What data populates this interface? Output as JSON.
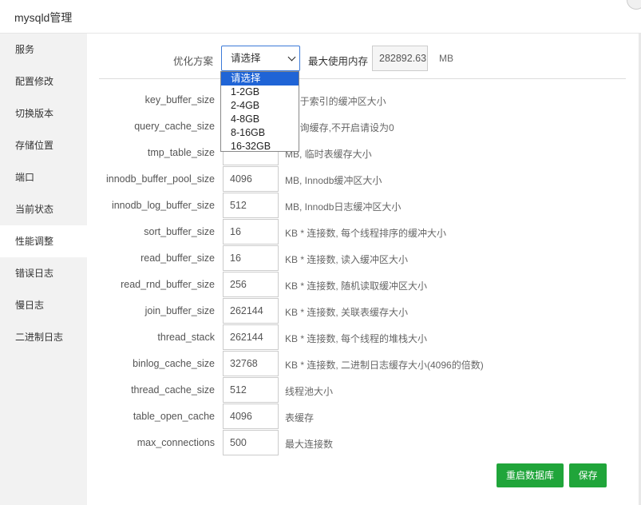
{
  "window": {
    "title": "mysqld管理"
  },
  "sidebar": {
    "items": [
      {
        "label": "服务"
      },
      {
        "label": "配置修改"
      },
      {
        "label": "切换版本"
      },
      {
        "label": "存储位置"
      },
      {
        "label": "端口"
      },
      {
        "label": "当前状态"
      },
      {
        "label": "性能调整",
        "active": true
      },
      {
        "label": "错误日志"
      },
      {
        "label": "慢日志"
      },
      {
        "label": "二进制日志"
      }
    ]
  },
  "optimize": {
    "label": "优化方案",
    "selected": "请选择",
    "options": [
      "请选择",
      "1-2GB",
      "2-4GB",
      "4-8GB",
      "8-16GB",
      "16-32GB"
    ],
    "max_mem_label": "最大使用内存",
    "max_mem_value": "282892.63",
    "max_mem_unit": "MB"
  },
  "params": [
    {
      "name": "key_buffer_size",
      "value": "",
      "desc": ", 用于索引的缓冲区大小"
    },
    {
      "name": "query_cache_size",
      "value": "",
      "desc": ", 查询缓存,不开启请设为0"
    },
    {
      "name": "tmp_table_size",
      "value": "",
      "desc": "MB, 临时表缓存大小"
    },
    {
      "name": "innodb_buffer_pool_size",
      "value": "4096",
      "desc": "MB, Innodb缓冲区大小"
    },
    {
      "name": "innodb_log_buffer_size",
      "value": "512",
      "desc": "MB, Innodb日志缓冲区大小"
    },
    {
      "name": "sort_buffer_size",
      "value": "16",
      "desc": "KB * 连接数, 每个线程排序的缓冲大小"
    },
    {
      "name": "read_buffer_size",
      "value": "16",
      "desc": "KB * 连接数, 读入缓冲区大小"
    },
    {
      "name": "read_rnd_buffer_size",
      "value": "256",
      "desc": "KB * 连接数, 随机读取缓冲区大小"
    },
    {
      "name": "join_buffer_size",
      "value": "262144",
      "desc": "KB * 连接数, 关联表缓存大小"
    },
    {
      "name": "thread_stack",
      "value": "262144",
      "desc": "KB * 连接数, 每个线程的堆栈大小"
    },
    {
      "name": "binlog_cache_size",
      "value": "32768",
      "desc": "KB * 连接数, 二进制日志缓存大小(4096的倍数)"
    },
    {
      "name": "thread_cache_size",
      "value": "512",
      "desc": "线程池大小"
    },
    {
      "name": "table_open_cache",
      "value": "4096",
      "desc": "表缓存"
    },
    {
      "name": "max_connections",
      "value": "500",
      "desc": "最大连接数"
    }
  ],
  "buttons": {
    "restart": "重启数据库",
    "save": "保存"
  },
  "colors": {
    "accent_green": "#20a53a",
    "select_blue": "#1f64d6"
  }
}
